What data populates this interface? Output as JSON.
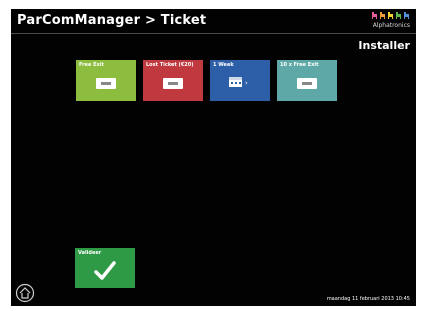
{
  "header": {
    "title": "ParComManager > Ticket",
    "brand": "Alphatronics"
  },
  "role": "Installer",
  "tiles": [
    {
      "label": "Free Exit",
      "color": "#8dbd3f",
      "icon": "ticket-icon"
    },
    {
      "label": "Lost Ticket (€20)",
      "color": "#c0393f",
      "icon": "ticket-icon"
    },
    {
      "label": "1 Week",
      "color": "#2d5fa8",
      "icon": "calendar-ticket-icon"
    },
    {
      "label": "10 x Free Exit",
      "color": "#5ea9a7",
      "icon": "ticket-icon"
    }
  ],
  "validate": {
    "label": "Valideer",
    "color": "#2f9a45",
    "icon": "checkmark-icon"
  },
  "footer": {
    "datetime": "maandag 11 februari 2013 10:45",
    "home_icon": "home-icon"
  }
}
